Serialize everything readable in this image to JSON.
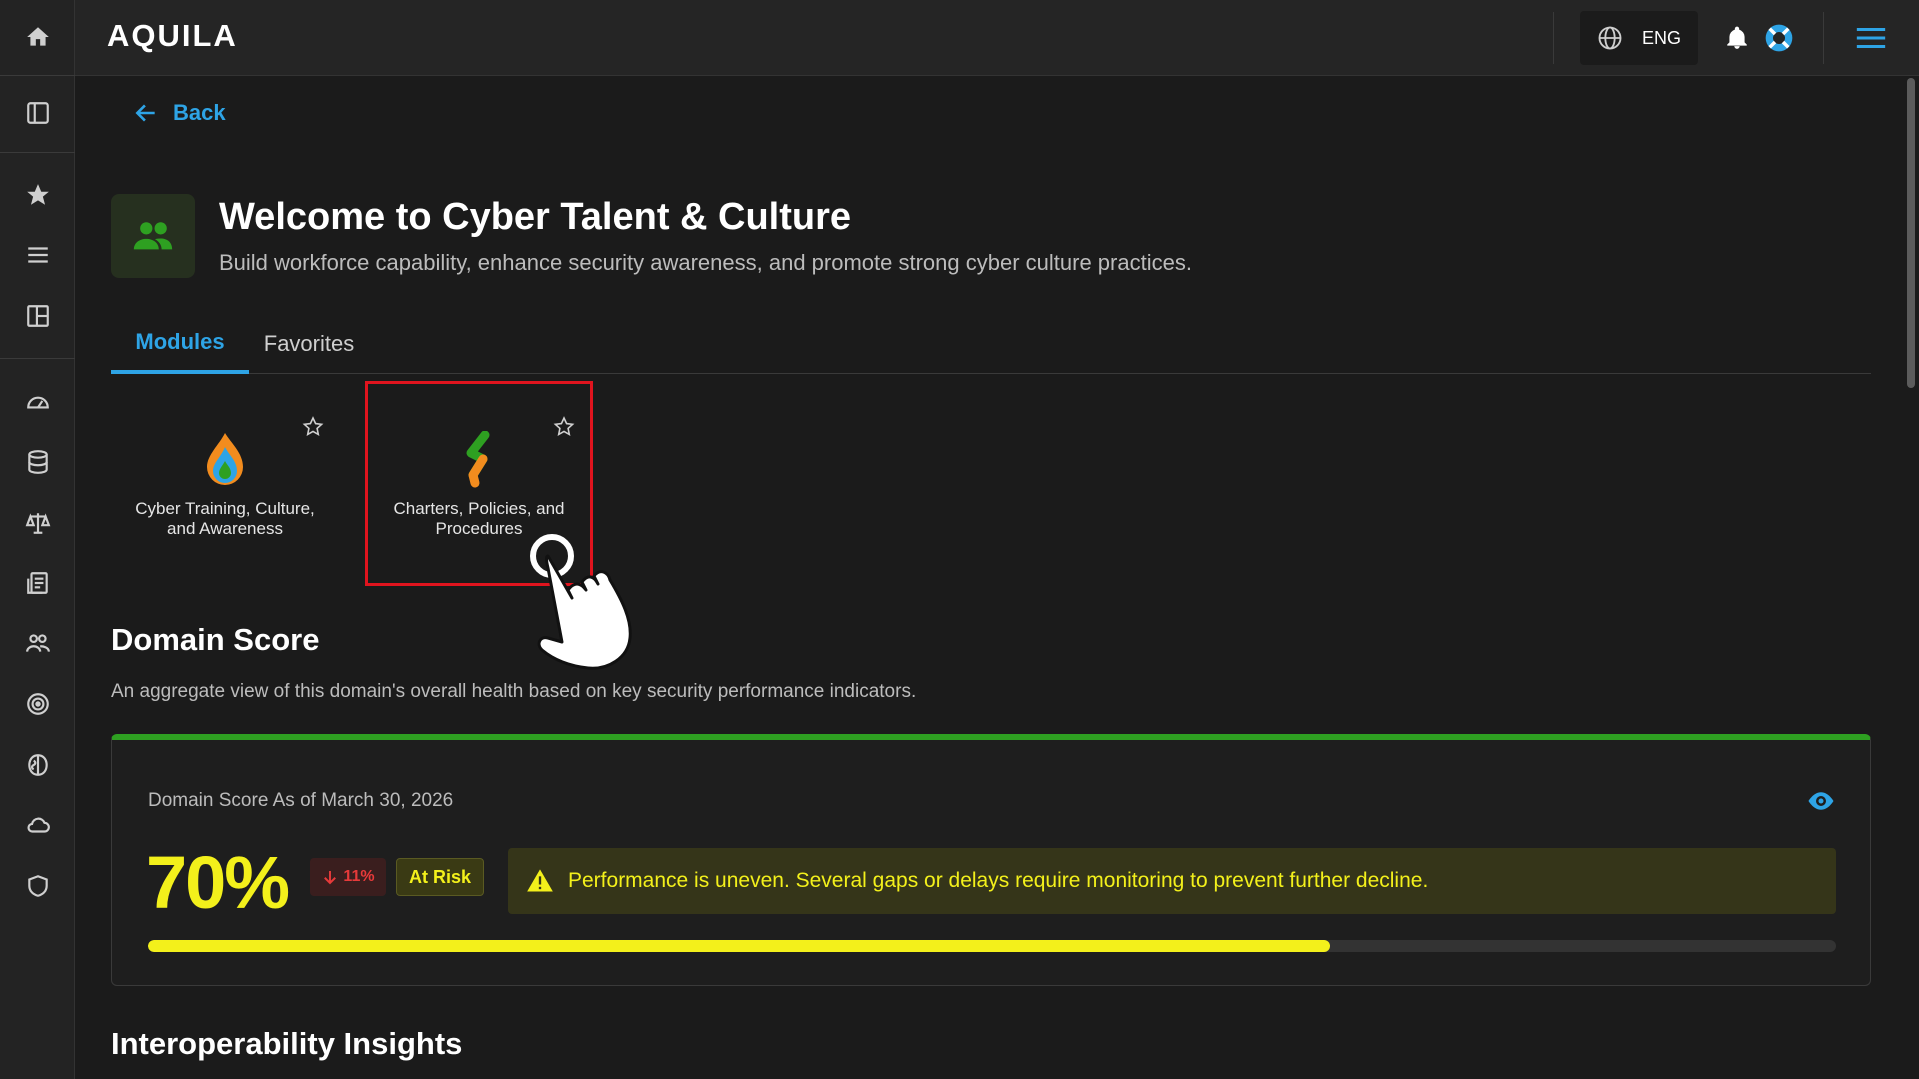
{
  "app": {
    "logo_text": "AQUILA"
  },
  "topbar": {
    "language": "ENG"
  },
  "sidebar": {
    "items": [
      {
        "icon": "home-icon"
      },
      {
        "icon": "panel-icon"
      },
      {
        "icon": "star-icon"
      },
      {
        "icon": "menu-icon"
      },
      {
        "icon": "layout-icon"
      },
      {
        "icon": "gauge-icon"
      },
      {
        "icon": "database-icon"
      },
      {
        "icon": "scale-icon"
      },
      {
        "icon": "report-icon"
      },
      {
        "icon": "users-icon"
      },
      {
        "icon": "target-icon"
      },
      {
        "icon": "brain-icon"
      },
      {
        "icon": "cloud-icon"
      },
      {
        "icon": "shield-icon"
      }
    ]
  },
  "page": {
    "back_label": "Back",
    "title": "Welcome to Cyber Talent & Culture",
    "subtitle": "Build workforce capability, enhance security awareness, and promote strong cyber culture practices."
  },
  "tabs": [
    {
      "label": "Modules",
      "active": true
    },
    {
      "label": "Favorites",
      "active": false
    }
  ],
  "modules": [
    {
      "label": "Cyber Training, Culture, and Awareness",
      "icon": "flame-drop-icon"
    },
    {
      "label": "Charters, Policies, and Procedures",
      "icon": "policy-s-icon",
      "selected": true
    }
  ],
  "domain_score": {
    "section_title": "Domain Score",
    "description": "An aggregate view of this domain's overall health based on key security performance indicators.",
    "date_label": "Domain Score As of March 30, 2026",
    "score": "70%",
    "score_value": 0.7,
    "delta": "11%",
    "status": "At Risk",
    "alert": "Performance is uneven. Several gaps or delays require monitoring to prevent further decline.",
    "colors": {
      "accent": "#2ea4e6",
      "score": "#f3f01b",
      "top_border": "#2ea021",
      "delta": "#e63a3a"
    }
  },
  "insights": {
    "section_title": "Interoperability Insights"
  }
}
